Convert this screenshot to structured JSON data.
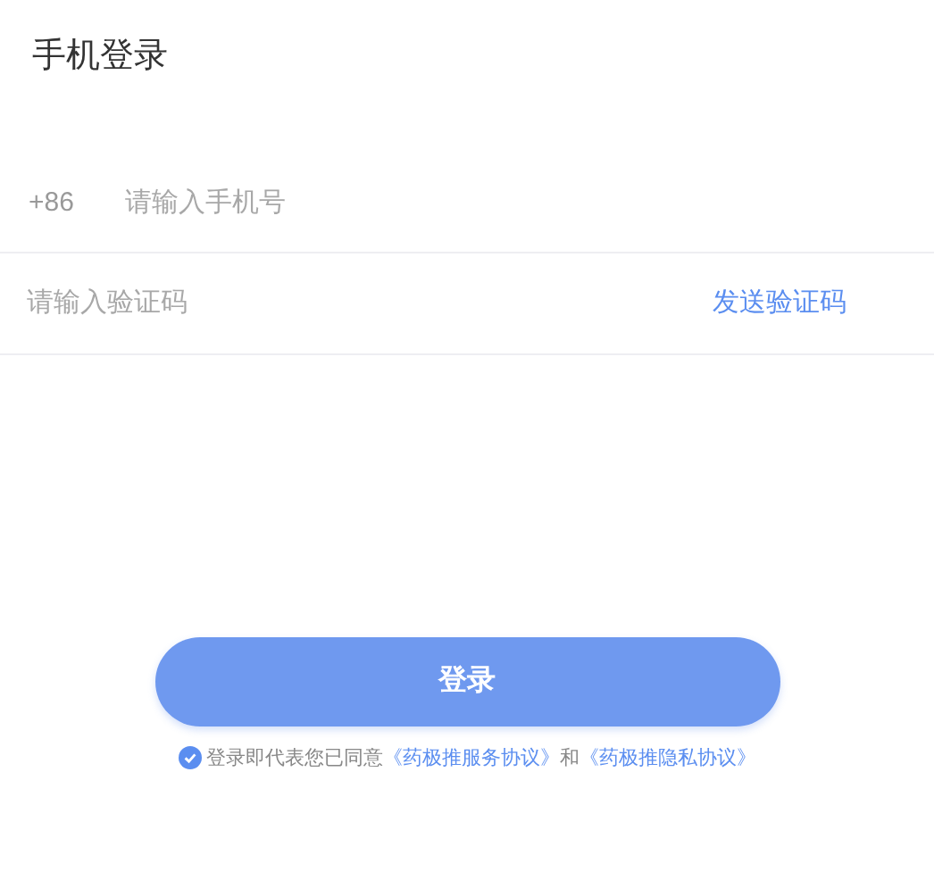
{
  "title": "手机登录",
  "phone": {
    "prefix": "+86",
    "placeholder": "请输入手机号"
  },
  "code": {
    "placeholder": "请输入验证码",
    "send_label": "发送验证码"
  },
  "login_button": "登录",
  "agreement": {
    "checked": true,
    "text": "登录即代表您已同意",
    "link1": "《药极推服务协议》",
    "joiner": "和",
    "link2": "《药极推隐私协议》"
  }
}
